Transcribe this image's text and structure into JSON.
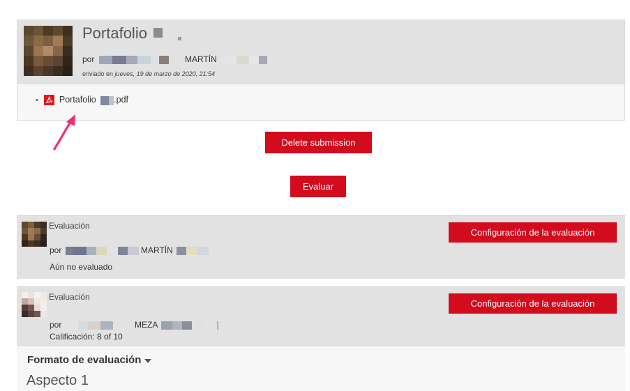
{
  "submission": {
    "title": "Portafolio",
    "by_label": "por",
    "author_visible": "MARTÍN",
    "sent_prefix": "enviado en",
    "sent_date": "jueves, 19 de marzo de 2020, 21:54",
    "attachment": {
      "name_prefix": "Portafolio",
      "name_suffix": ".pdf",
      "icon": "pdf-icon"
    }
  },
  "actions": {
    "delete_label": "Delete submission",
    "evaluate_label": "Evaluar"
  },
  "assessments": [
    {
      "label": "Evaluación",
      "by_label": "por",
      "assessor_visible": "MARTÍN",
      "status": "Aún no evaluado",
      "config_button": "Configuración de la evaluación"
    },
    {
      "label": "Evaluación",
      "by_label": "por",
      "assessor_visible": "MEZA",
      "status": "Calificación: 8 of 10",
      "config_button": "Configuración de la evaluación"
    }
  ],
  "rubric": {
    "format_label": "Formato de evaluación",
    "aspect_label": "Aspecto 1"
  },
  "colors": {
    "primary_button": "#d20b1d",
    "header_bg": "#e2e2e2",
    "annotation_arrow": "#f0306e",
    "pdf_icon": "#e0171f"
  }
}
